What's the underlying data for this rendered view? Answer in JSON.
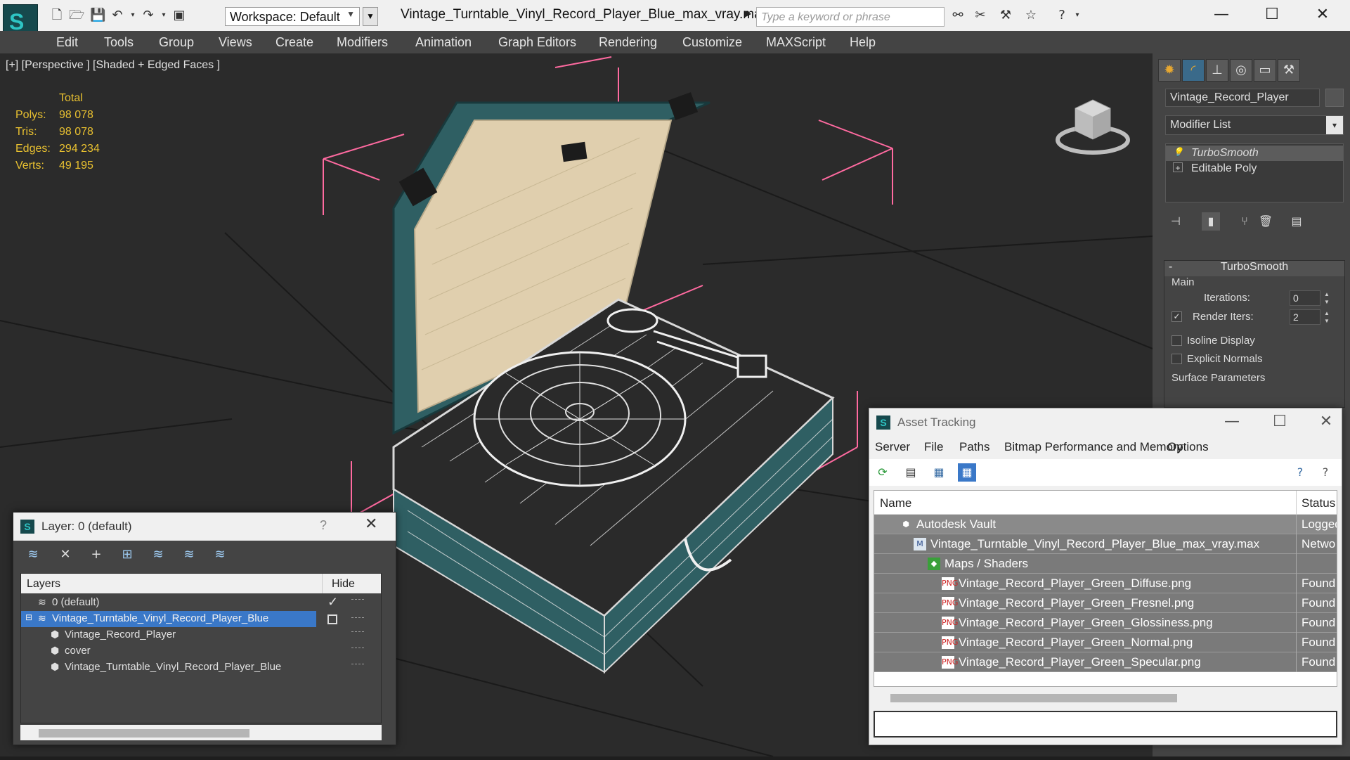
{
  "titlebar": {
    "workspace": "Workspace: Default",
    "file_title": "Vintage_Turntable_Vinyl_Record_Player_Blue_max_vray.max",
    "search_placeholder": "Type a keyword or phrase",
    "icons": [
      "new-file-icon",
      "open-file-icon",
      "save-icon",
      "undo-icon",
      "redo-icon",
      "project-icon",
      "binoculars-icon",
      "tools-icon",
      "star-icon",
      "help-icon"
    ]
  },
  "menubar": {
    "items": [
      "Edit",
      "Tools",
      "Group",
      "Views",
      "Create",
      "Modifiers",
      "Animation",
      "Graph Editors",
      "Rendering",
      "Customize",
      "MAXScript",
      "Help"
    ]
  },
  "viewport": {
    "label": "[+] [Perspective ] [Shaded + Edged Faces ]",
    "stats": {
      "header": "Total",
      "polys_label": "Polys:",
      "polys": "98 078",
      "tris_label": "Tris:",
      "tris": "98 078",
      "edges_label": "Edges:",
      "edges": "294 234",
      "verts_label": "Verts:",
      "verts": "49 195"
    },
    "colors": {
      "stats": "#e8c030",
      "selection_brackets": "#ff6aa0",
      "case": "#2f5f63",
      "lining": "#e0cfae"
    }
  },
  "command_panel": {
    "object_name": "Vintage_Record_Player",
    "modifier_list": "Modifier List",
    "stack": [
      "TurboSmooth",
      "Editable Poly"
    ],
    "rollout_title": "TurboSmooth",
    "group_main": "Main",
    "iterations_label": "Iterations:",
    "iterations": "0",
    "render_iters_label": "Render Iters:",
    "render_iters": "2",
    "render_iters_checked": true,
    "isoline_label": "Isoline Display",
    "explicit_normals_label": "Explicit Normals",
    "surface_params": "Surface Parameters"
  },
  "layer_window": {
    "title": "Layer: 0 (default)",
    "help": "?",
    "col_layers": "Layers",
    "col_hide": "Hide",
    "rows": [
      {
        "name": "0 (default)"
      },
      {
        "name": "Vintage_Turntable_Vinyl_Record_Player_Blue"
      },
      {
        "name": "Vintage_Record_Player"
      },
      {
        "name": "cover"
      },
      {
        "name": "Vintage_Turntable_Vinyl_Record_Player_Blue"
      }
    ]
  },
  "asset_window": {
    "title": "Asset Tracking",
    "menu": [
      "Server",
      "File",
      "Paths",
      "Bitmap Performance and Memory",
      "Options"
    ],
    "col_name": "Name",
    "col_status": "Status",
    "rows": [
      {
        "name": "Autodesk Vault",
        "status": "Logged"
      },
      {
        "name": "Vintage_Turntable_Vinyl_Record_Player_Blue_max_vray.max",
        "status": "Netwo"
      },
      {
        "name": "Maps / Shaders",
        "status": ""
      },
      {
        "name": "Vintage_Record_Player_Green_Diffuse.png",
        "status": "Found"
      },
      {
        "name": "Vintage_Record_Player_Green_Fresnel.png",
        "status": "Found"
      },
      {
        "name": "Vintage_Record_Player_Green_Glossiness.png",
        "status": "Found"
      },
      {
        "name": "Vintage_Record_Player_Green_Normal.png",
        "status": "Found"
      },
      {
        "name": "Vintage_Record_Player_Green_Specular.png",
        "status": "Found"
      }
    ]
  }
}
